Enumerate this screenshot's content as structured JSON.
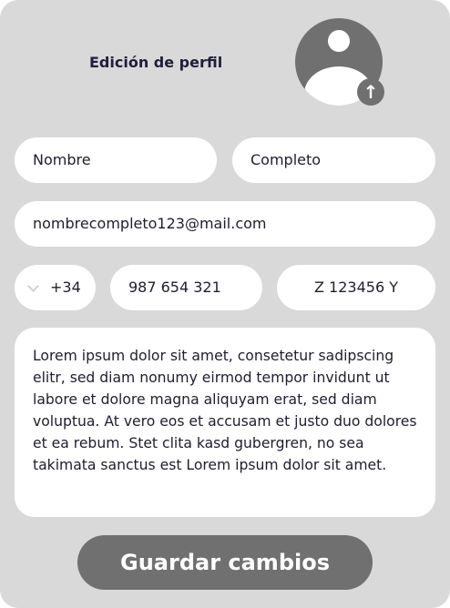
{
  "header": {
    "title": "Edición de perfil"
  },
  "avatar": {
    "icon": "user-avatar-icon",
    "upload_icon": "arrow-up-icon",
    "upload_glyph": "↑"
  },
  "form": {
    "first_name": "Nombre",
    "last_name": "Completo",
    "email": "nombrecompleto123@mail.com",
    "country_code": "+34",
    "phone": "987 654 321",
    "id_number": "Z 123456 Y",
    "bio": "Lorem ipsum dolor sit amet, consetetur sadipscing elitr, sed diam nonumy eirmod tempor invidunt ut labore et dolore magna aliquyam erat, sed diam voluptua. At vero eos et accusam et justo duo dolores et ea rebum. Stet clita kasd gubergren, no sea takimata sanctus est Lorem ipsum dolor sit amet."
  },
  "save_label": "Guardar cambios",
  "colors": {
    "background": "#d9d9d9",
    "accent": "#707070",
    "text": "#1e1e2e"
  }
}
